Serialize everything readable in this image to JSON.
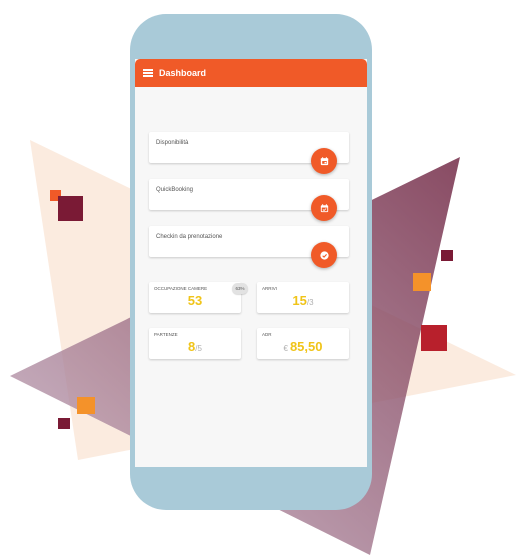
{
  "appbar": {
    "title": "Dashboard",
    "menu_icon": "hamburger-menu-icon"
  },
  "actions": [
    {
      "label": "Disponibilità",
      "icon": "calendar-icon"
    },
    {
      "label": "QuickBooking",
      "icon": "calendar-check-icon"
    },
    {
      "label": "Checkin da prenotazione",
      "icon": "check-circle-icon"
    }
  ],
  "stats": {
    "occupazione": {
      "label": "OCCUPAZIONE CAMERE",
      "value": "53",
      "badge": "63%"
    },
    "arrivi": {
      "label": "ARRIVI",
      "value": "15",
      "sub": "/3"
    },
    "partenze": {
      "label": "PARTENZE",
      "value": "8",
      "sub": "/5"
    },
    "adr": {
      "label": "ADR",
      "prefix": "€",
      "value": "85,50"
    }
  },
  "colors": {
    "accent": "#f05a28",
    "value": "#f0c419",
    "phone": "#a9cad8",
    "screen": "#f7f7f7"
  }
}
